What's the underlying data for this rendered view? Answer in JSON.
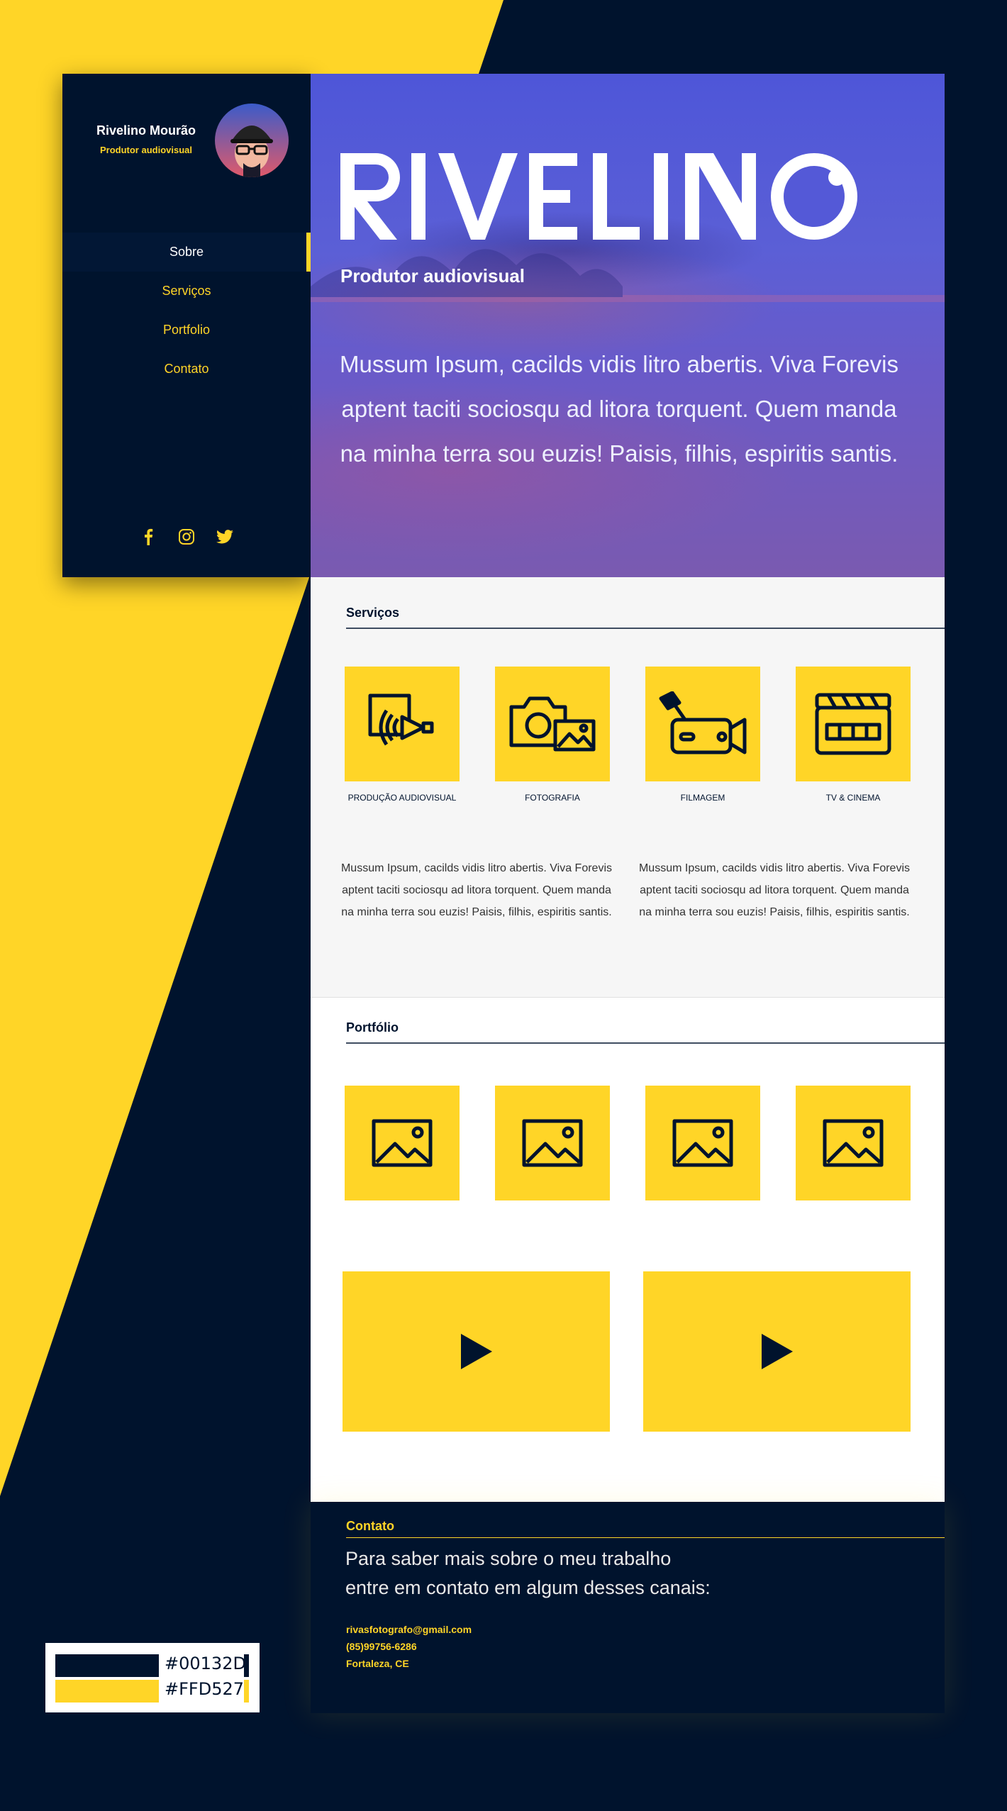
{
  "colors": {
    "navy": "#00132D",
    "yellow": "#FFD527"
  },
  "sidebar": {
    "name": "Rivelino Mourão",
    "role": "Produtor audiovisual",
    "nav": [
      {
        "label": "Sobre",
        "active": true
      },
      {
        "label": "Serviços",
        "active": false
      },
      {
        "label": "Portfolio",
        "active": false
      },
      {
        "label": "Contato",
        "active": false
      }
    ],
    "socials": [
      "facebook-icon",
      "instagram-icon",
      "twitter-icon"
    ]
  },
  "hero": {
    "logo": "RIVELINO",
    "subtitle": "Produtor audiovisual",
    "text": "Mussum Ipsum, cacilds vidis litro abertis. Viva Forevis aptent taciti sociosqu ad litora torquent. Quem manda na minha terra sou euzis! Paisis, filhis, espiritis santis."
  },
  "services": {
    "title": "Serviços",
    "items": [
      {
        "label": "PRODUÇÃO AUDIOVISUAL",
        "icon": "audiovisual-icon"
      },
      {
        "label": "FOTOGRAFIA",
        "icon": "photo-camera-icon"
      },
      {
        "label": "FILMAGEM",
        "icon": "video-camera-icon"
      },
      {
        "label": "TV & CINEMA",
        "icon": "clapperboard-icon"
      }
    ],
    "texts": [
      "Mussum Ipsum, cacilds vidis litro abertis. Viva Forevis aptent taciti sociosqu ad litora torquent. Quem manda na minha terra sou euzis! Paisis, filhis, espiritis santis.",
      "Mussum Ipsum, cacilds vidis litro abertis. Viva Forevis aptent taciti sociosqu ad litora torquent. Quem manda na minha terra sou euzis! Paisis, filhis, espiritis santis."
    ]
  },
  "portfolio": {
    "title": "Portfólio",
    "images": [
      "image-icon",
      "image-icon",
      "image-icon",
      "image-icon"
    ],
    "videos": [
      "play-icon",
      "play-icon"
    ]
  },
  "contact": {
    "title": "Contato",
    "line1": "Para saber mais sobre o meu trabalho",
    "line2": "entre em contato em algum desses canais:",
    "email": "rivasfotografo@gmail.com",
    "phone": "(85)99756-6286",
    "city": "Fortaleza, CE"
  },
  "palette": [
    {
      "hex": "#00132D"
    },
    {
      "hex": "#FFD527"
    }
  ]
}
